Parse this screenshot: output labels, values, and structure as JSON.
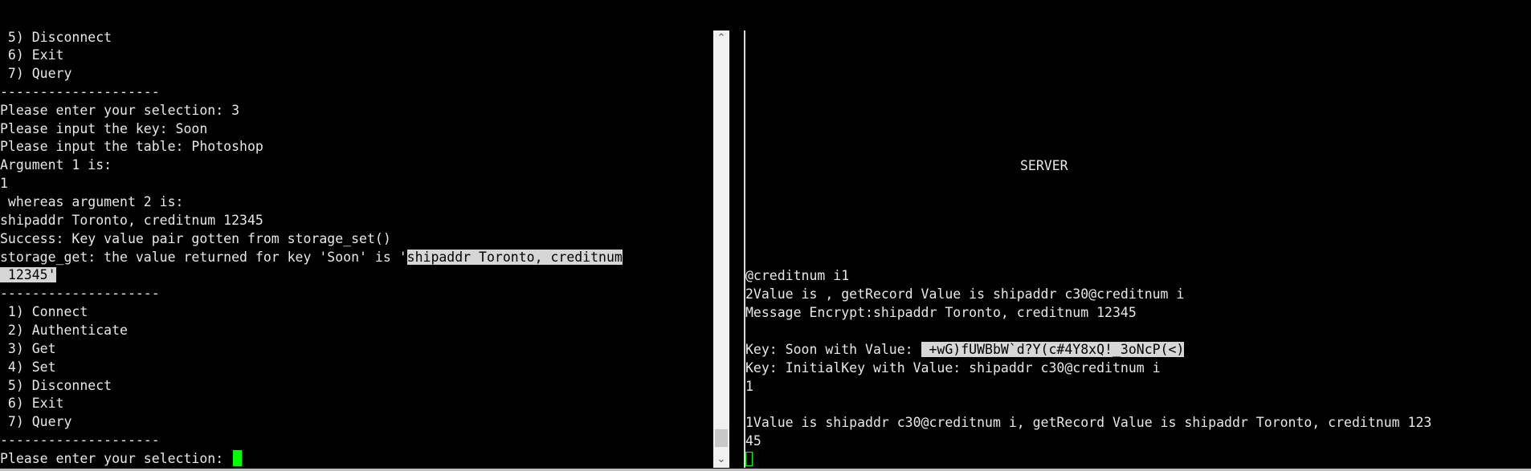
{
  "left_terminal": {
    "lines": [
      " 5) Disconnect",
      " 6) Exit",
      " 7) Query",
      "--------------------",
      "Please enter your selection: 3",
      "Please input the key: Soon",
      "Please input the table: Photoshop",
      "Argument 1 is:",
      "1",
      " whereas argument 2 is:",
      "shipaddr Toronto, creditnum 12345",
      "Success: Key value pair gotten from storage_set()",
      "storage_get: the value returned for key 'Soon' is '",
      "shipaddr Toronto, creditnum",
      " 12345'",
      "--------------------",
      " 1) Connect",
      " 2) Authenticate",
      " 3) Get",
      " 4) Set",
      " 5) Disconnect",
      " 6) Exit",
      " 7) Query",
      "--------------------",
      "Please enter your selection: "
    ]
  },
  "right_terminal": {
    "title": "SERVER",
    "lines": [
      "@creditnum i1",
      "2Value is , getRecord Value is shipaddr c30@creditnum i",
      "Message Encrypt:shipaddr Toronto, creditnum 12345",
      "",
      "Key: Soon with Value: ",
      " +wG)fUWBbW`d?Y(c#4Y8xQ!_3oNcP(<)",
      "Key: InitialKey with Value: shipaddr c30@creditnum i",
      "1",
      "",
      "1Value is shipaddr c30@creditnum i, getRecord Value is shipaddr Toronto, creditnum 123",
      "45"
    ]
  },
  "scrollbar": {
    "up_icon": "▲",
    "down_icon": "▼",
    "up_glyph": "⌃",
    "down_glyph": "⌄"
  },
  "colors": {
    "background": "#000000",
    "text": "#e8e8e8",
    "cursor": "#00ff00",
    "selection": "#d6d6d6"
  }
}
